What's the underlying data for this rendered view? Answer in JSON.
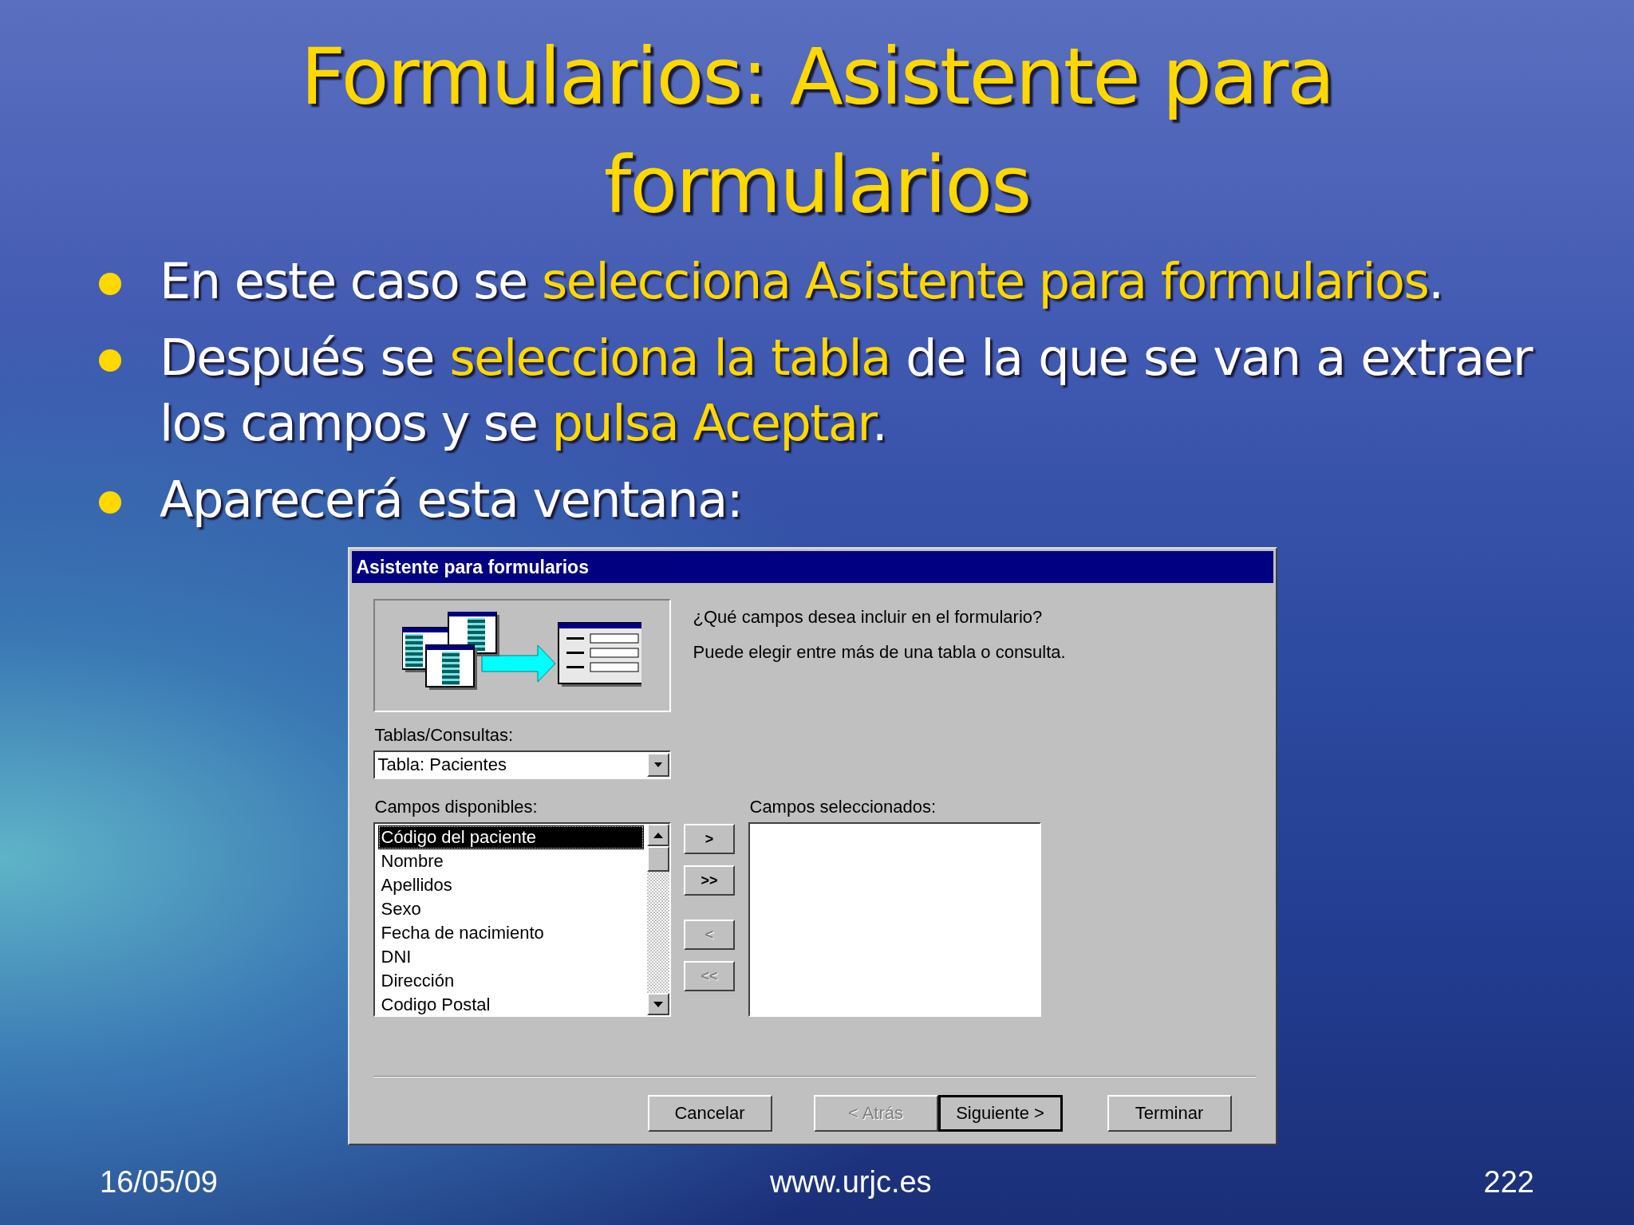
{
  "slide": {
    "title": "Formularios: Asistente para formularios",
    "bullets": [
      [
        {
          "text": "En este caso se ",
          "highlight": false
        },
        {
          "text": "selecciona Asistente para formularios",
          "highlight": true
        },
        {
          "text": ".",
          "highlight": false
        }
      ],
      [
        {
          "text": "Después se ",
          "highlight": false
        },
        {
          "text": "selecciona la tabla",
          "highlight": true
        },
        {
          "text": " de la que se van a extraer los campos y se ",
          "highlight": false
        },
        {
          "text": "pulsa Aceptar",
          "highlight": true
        },
        {
          "text": ".",
          "highlight": false
        }
      ],
      [
        {
          "text": "Aparecerá esta ventana:",
          "highlight": false
        }
      ]
    ]
  },
  "dialog": {
    "title": "Asistente para formularios",
    "prompt": "¿Qué campos desea incluir en el formulario?",
    "hint": "Puede elegir entre más de una tabla o consulta.",
    "tables_label": "Tablas/Consultas:",
    "tables_value": "Tabla: Pacientes",
    "available_label": "Campos disponibles:",
    "available_fields": [
      {
        "label": "Código del paciente",
        "selected": true
      },
      {
        "label": "Nombre",
        "selected": false
      },
      {
        "label": "Apellidos",
        "selected": false
      },
      {
        "label": "Sexo",
        "selected": false
      },
      {
        "label": "Fecha de nacimiento",
        "selected": false
      },
      {
        "label": "DNI",
        "selected": false
      },
      {
        "label": "Dirección",
        "selected": false
      },
      {
        "label": "Codigo Postal",
        "selected": false
      }
    ],
    "move_buttons": [
      {
        "label": ">",
        "disabled": false
      },
      {
        "label": ">>",
        "disabled": false
      },
      {
        "label": "<",
        "disabled": true
      },
      {
        "label": "<<",
        "disabled": true
      }
    ],
    "selected_label": "Campos seleccionados:",
    "buttons": [
      {
        "label": "Cancelar",
        "disabled": false,
        "default": false
      },
      {
        "label": "< Atrás",
        "disabled": true,
        "default": false
      },
      {
        "label": "Siguiente >",
        "disabled": false,
        "default": true
      },
      {
        "label": "Terminar",
        "disabled": false,
        "default": false
      }
    ]
  },
  "footer": {
    "date": "16/05/09",
    "site": "www.urjc.es",
    "page": "222"
  }
}
